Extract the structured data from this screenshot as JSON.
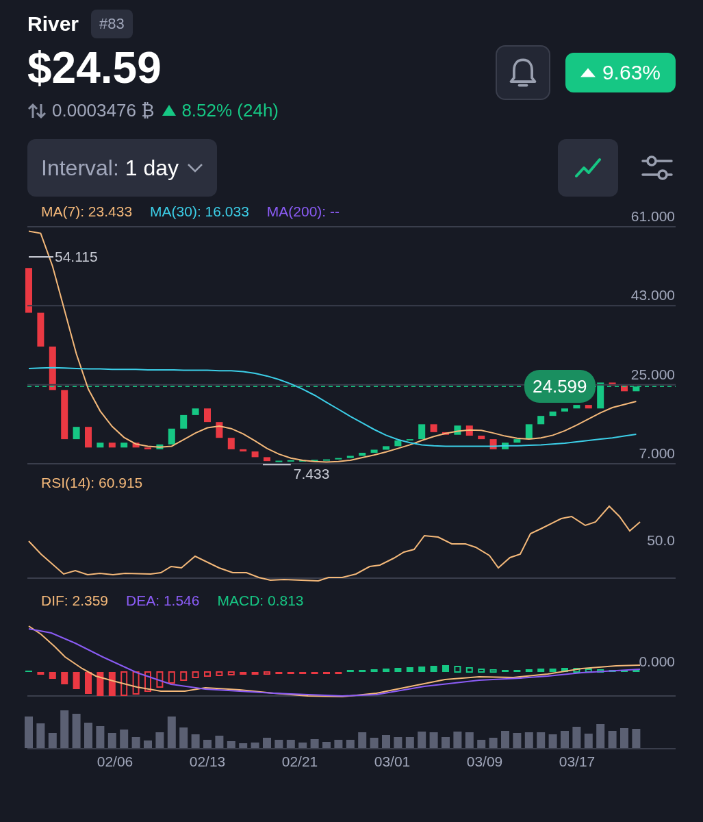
{
  "coin": {
    "name": "River",
    "rank": "#83"
  },
  "price": "$24.59",
  "btc_line": {
    "btc_price": "0.0003476 ₿",
    "change": "8.52% (24h)",
    "rising": true
  },
  "change_badge": {
    "text": "9.63%",
    "rising": true
  },
  "interval": {
    "label": "Interval:",
    "value": "1 day"
  },
  "chart_view": {
    "selected": true
  },
  "price_chart": {
    "extra_indicator": {
      "label": "MA(200): --",
      "color": "#8b5cf6"
    },
    "current_price_label": "24.599",
    "high_label": "54.115",
    "low_label": "7.433",
    "chart_data": {
      "type": "line",
      "ylim": [
        7,
        61
      ],
      "yticks": [
        {
          "value": 61,
          "label": "61.000"
        },
        {
          "value": 43,
          "label": "43.000"
        },
        {
          "value": 25,
          "label": "25.000"
        },
        {
          "value": 7,
          "label": "7.000"
        }
      ],
      "series": [
        {
          "name": "MA(7): 23.433",
          "color": "#f5b97a",
          "values": [
            60,
            59.5,
            52,
            42,
            32,
            24,
            19,
            15.5,
            13,
            11.5,
            11,
            10.8,
            11,
            12.5,
            14,
            15.2,
            15.6,
            15,
            13.8,
            12.2,
            10.5,
            9.2,
            8.3,
            7.8,
            7.5,
            7.4,
            7.5,
            7.8,
            8.4,
            9.0,
            9.7,
            10.5,
            11.3,
            12.3,
            13.2,
            13.9,
            14.4,
            14.7,
            14.6,
            14.0,
            13.3,
            12.8,
            12.6,
            12.9,
            13.5,
            14.5,
            15.8,
            17.2,
            18.6,
            19.8,
            20.5,
            21.2
          ]
        },
        {
          "name": "MA(30): 16.033",
          "color": "#3ccfe8",
          "values": [
            28.7,
            28.8,
            28.9,
            28.8,
            28.7,
            28.6,
            28.6,
            28.5,
            28.5,
            28.5,
            28.4,
            28.4,
            28.4,
            28.3,
            28.3,
            28.3,
            28.2,
            28.2,
            28.0,
            27.6,
            27.0,
            26.2,
            25.2,
            24.0,
            22.6,
            21.0,
            19.4,
            17.8,
            16.3,
            14.8,
            13.5,
            12.5,
            11.8,
            11.3,
            11.1,
            11.0,
            11.0,
            11.0,
            11.0,
            11.0,
            11.1,
            11.1,
            11.2,
            11.3,
            11.5,
            11.7,
            12.0,
            12.3,
            12.6,
            12.9,
            13.3,
            13.7
          ]
        }
      ]
    }
  },
  "rsi": {
    "label": "RSI(14): 60.915",
    "tick": "50.0"
  },
  "macd": {
    "indicators": [
      {
        "label": "DIF: 2.359",
        "color": "#f5b97a"
      },
      {
        "label": "DEA: 1.546",
        "color": "#8b5cf6"
      },
      {
        "label": "MACD: 0.813",
        "color": "#16c784"
      }
    ],
    "tick": "0.000"
  },
  "x_axis": [
    "02/06",
    "02/13",
    "02/21",
    "03/01",
    "03/09",
    "03/17"
  ]
}
